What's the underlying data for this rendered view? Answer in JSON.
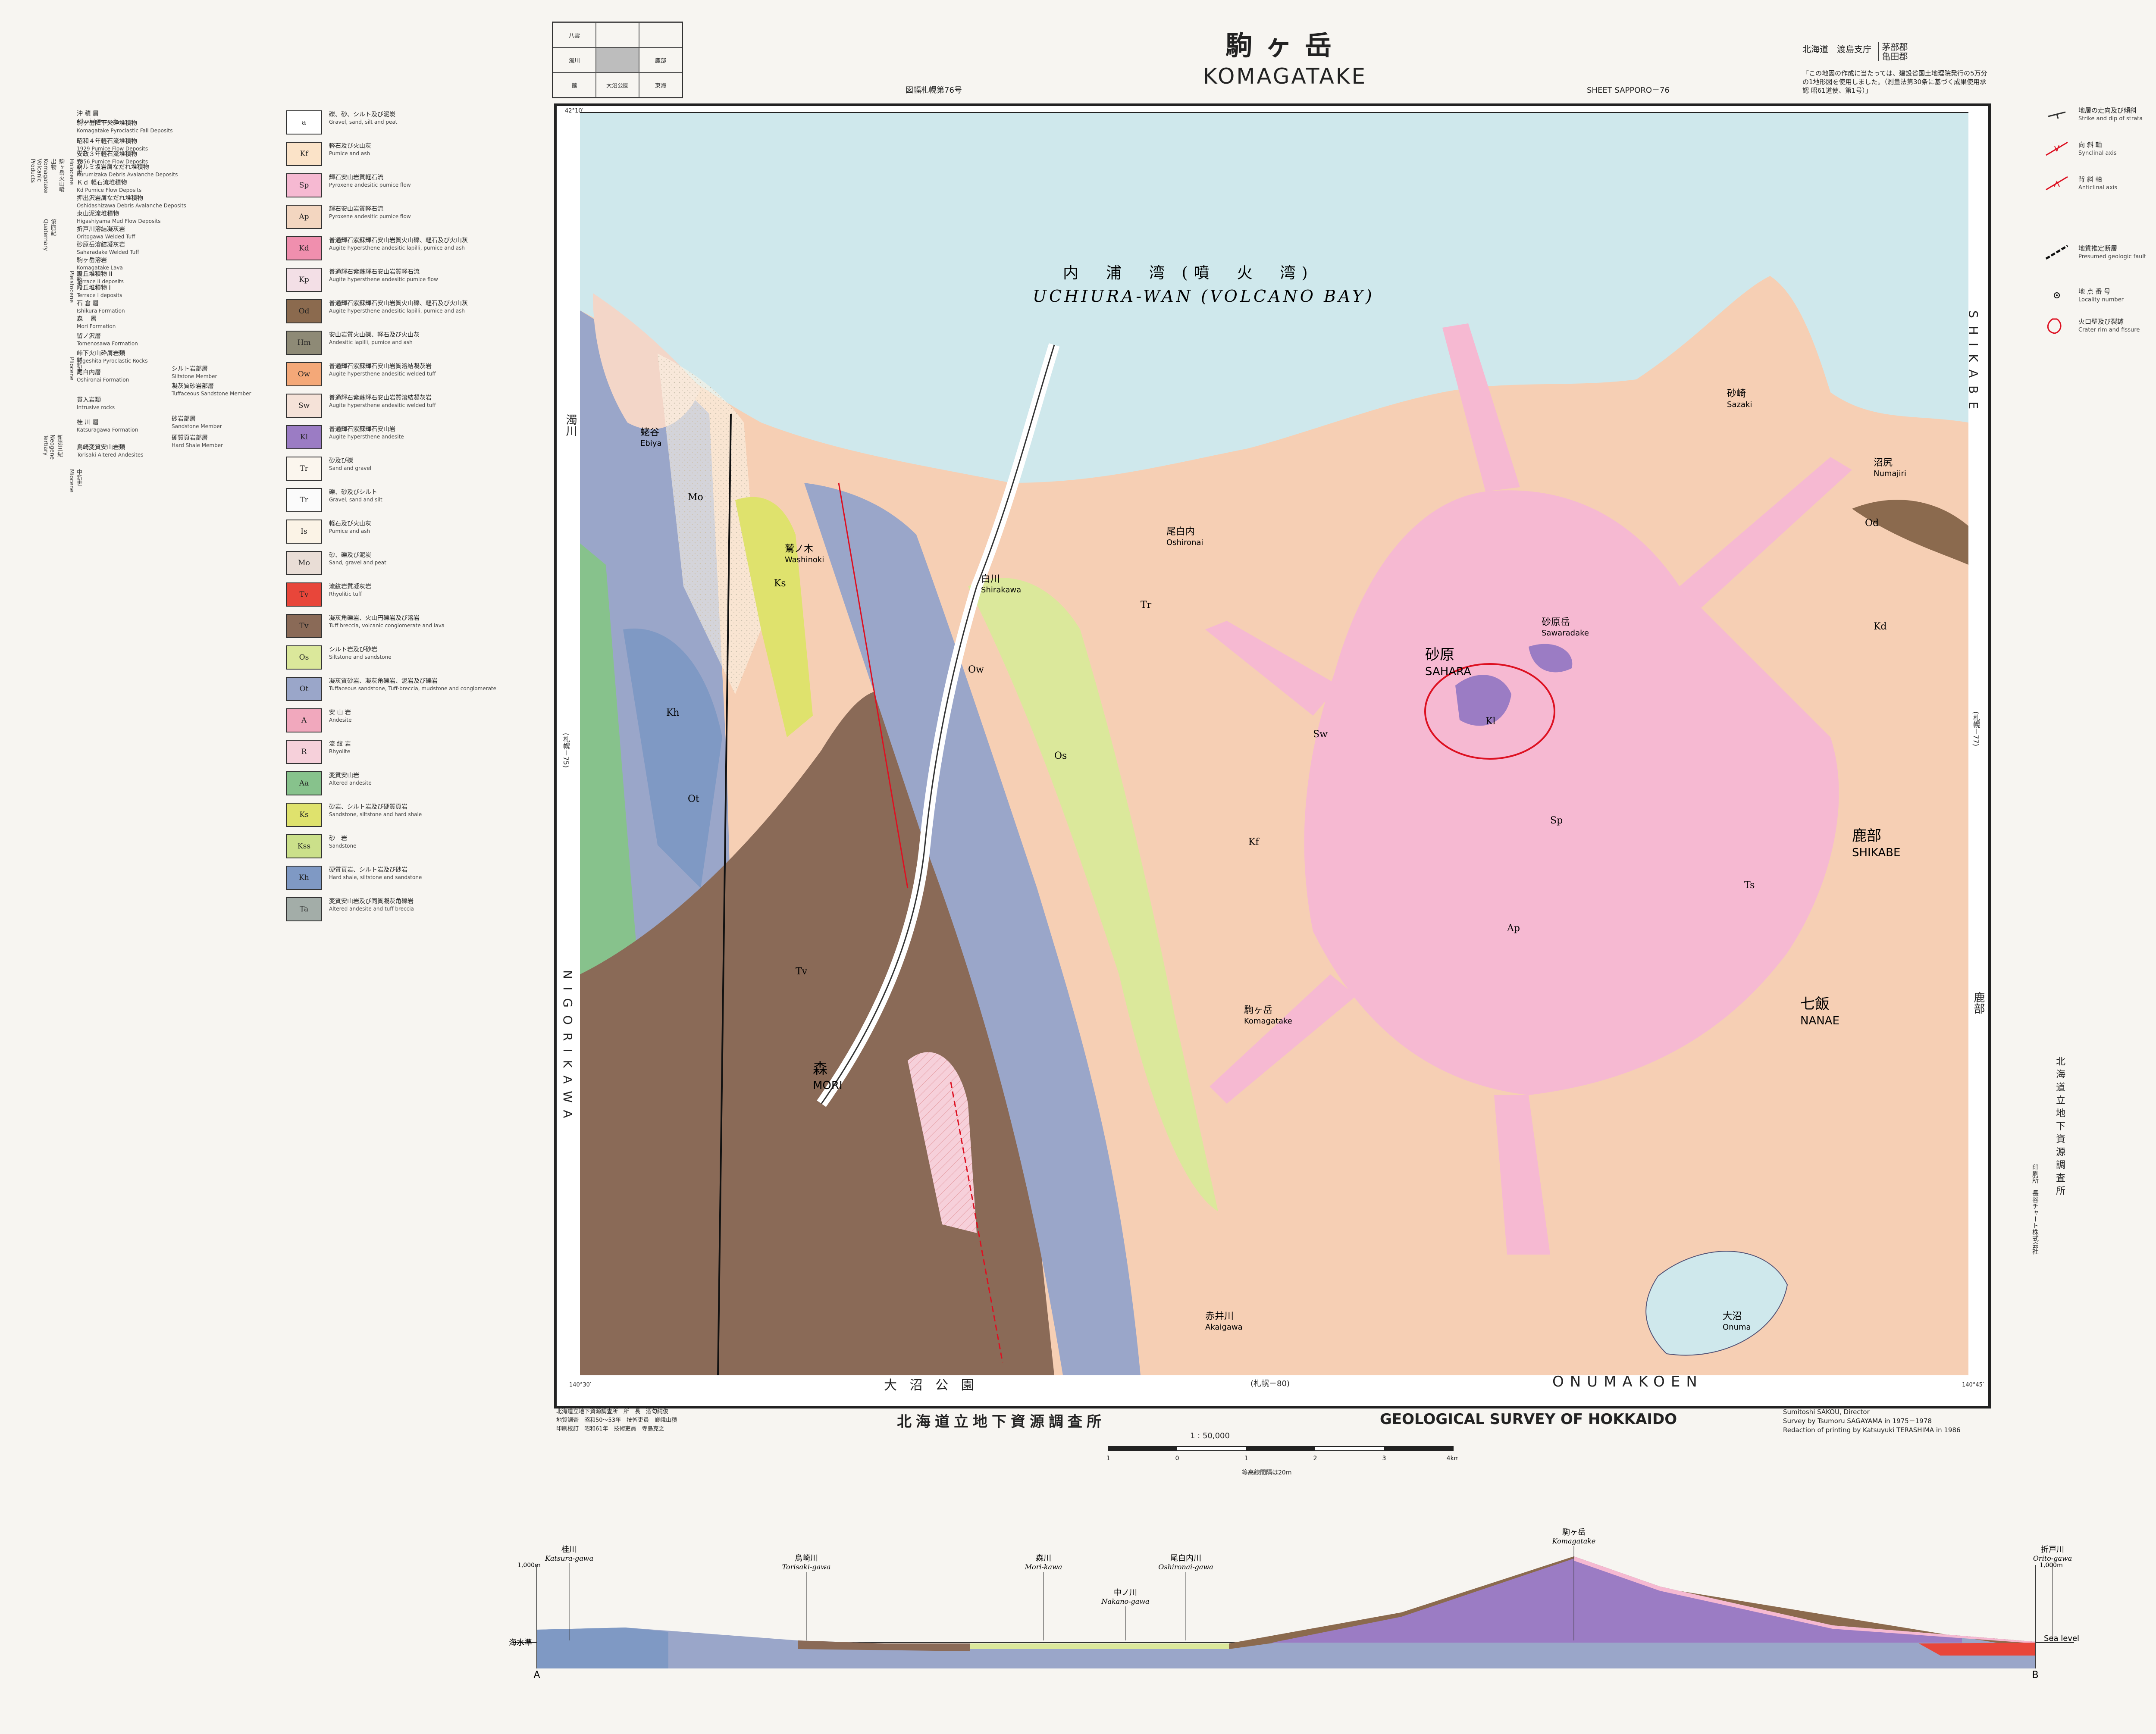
{
  "header": {
    "title_jp": "駒ヶ岳",
    "title_en": "KOMAGATAKE",
    "sheet_left": "図幅札幌第76号",
    "sheet_right": "SHEET SAPPORO－76",
    "prefecture": "北海道　渡島支庁",
    "prefecture_towns": [
      "茅部郡",
      "亀田郡"
    ],
    "notice": "「この地図の作成に当たっては、建設省国土地理院発行の5万分の1地形図を使用しました。（測量法第30条に基づく成果使用承認 昭61道使、第1号）」",
    "index_map": [
      "八雲",
      "",
      "",
      "濁川",
      "",
      "鹿部",
      "館",
      "大沼公園",
      "東海"
    ]
  },
  "map": {
    "bay_jp": "内　浦　湾 (噴　火　湾)",
    "bay_en": "UCHIURA-WAN (VOLCANO BAY)",
    "place_names": [
      {
        "jp": "森",
        "en": "MORI"
      },
      {
        "jp": "砂原",
        "en": "SAHARA"
      },
      {
        "jp": "鹿部",
        "en": "SHIKABE"
      },
      {
        "jp": "七飯",
        "en": "NANAE"
      },
      {
        "jp": "駒ヶ岳",
        "en": "Komagatake"
      },
      {
        "jp": "白川",
        "en": "Shirakawa"
      },
      {
        "jp": "尾白内",
        "en": "Oshironai"
      },
      {
        "jp": "鷲ノ木",
        "en": "Washinoki"
      },
      {
        "jp": "蛯谷",
        "en": "Ebiya"
      },
      {
        "jp": "砂崎",
        "en": "Sazaki"
      },
      {
        "jp": "沼尻",
        "en": "Numajiri"
      },
      {
        "jp": "大沼",
        "en": "Onuma"
      },
      {
        "jp": "赤井川",
        "en": "Akaigawa"
      },
      {
        "jp": "砂原岳",
        "en": "Sawaradake"
      }
    ],
    "left_edge": "NIGORIKAWA",
    "left_edge_jp": "濁川",
    "right_edge": "SHIKABE",
    "right_edge_jp": "鹿部",
    "bottom_edge_jp": "大 沼 公 園",
    "bottom_edge_en": "ONUMAKOEN",
    "sheet_bottom": "(札幌－80)",
    "sheet_left_side": "(札幌－75)",
    "sheet_right_side": "(札幌－77)",
    "corner_lat": "42°10′",
    "corner_lon_left": "140°30′",
    "corner_lon_right": "140°45′",
    "unit_labels": [
      "Kf",
      "Sp",
      "Ap",
      "Kd",
      "Od",
      "Ot",
      "Os",
      "Tv",
      "Kl",
      "Mo",
      "Sw",
      "Ts",
      "Kh",
      "Ks",
      "Tr",
      "Ow"
    ]
  },
  "legend": {
    "strata": [
      {
        "jp": "沖 積 層",
        "en": "Alluvial Deposits"
      },
      {
        "jp": "駒ヶ岳降下火砕堆積物",
        "en": "Komagatake Pyroclastic Fall Deposits"
      },
      {
        "jp": "昭和４年軽石流堆積物",
        "en": "1929 Pumice Flow Deposits"
      },
      {
        "jp": "安政３年軽石流堆積物",
        "en": "1856 Pumice Flow Deposits"
      },
      {
        "jp": "クルミ坂岩屑なだれ堆積物",
        "en": "Kurumizaka Debris Avalanche Deposits"
      },
      {
        "jp": "Ｋｄ 軽石流堆積物",
        "en": "Kd Pumice Flow Deposits"
      },
      {
        "jp": "押出沢岩屑なだれ堆積物",
        "en": "Oshidashizawa Debris Avalanche Deposits"
      },
      {
        "jp": "東山泥流堆積物",
        "en": "Higashiyama Mud Flow Deposits"
      },
      {
        "jp": "折戸川溶結凝灰岩",
        "en": "Oritogawa Welded Tuff"
      },
      {
        "jp": "砂原岳溶結凝灰岩",
        "en": "Saharadake Welded Tuff"
      },
      {
        "jp": "駒ヶ岳溶岩",
        "en": "Komagatake Lava"
      },
      {
        "jp": "段丘堆積物 II",
        "en": "Terrace II deposits"
      },
      {
        "jp": "段丘堆積物 I",
        "en": "Terrace I deposits"
      },
      {
        "jp": "石 倉 層",
        "en": "Ishikura Formation"
      },
      {
        "jp": "森 　層",
        "en": "Mori Formation"
      },
      {
        "jp": "留ノ沢層",
        "en": "Tomenosawa Formation"
      },
      {
        "jp": "峠下火山砕屑岩類",
        "en": "Tôgeshita Pyroclastic Rocks"
      },
      {
        "jp": "尾白内層",
        "en": "Oshironai Formation"
      },
      {
        "jp": "貫入岩類",
        "en": "Intrusive rocks"
      },
      {
        "jp": "桂 川 層",
        "en": "Katsuragawa Formation"
      },
      {
        "jp": "鳥崎変質安山岩類",
        "en": "Torisaki Altered Andesites"
      }
    ],
    "members": [
      {
        "jp": "シルト岩部層",
        "en": "Siltstone Member"
      },
      {
        "jp": "凝灰質砂岩部層",
        "en": "Tuffaceous Sandstone Member"
      },
      {
        "jp": "砂岩部層",
        "en": "Sandstone Member"
      },
      {
        "jp": "硬質頁岩部層",
        "en": "Hard Shale Member"
      }
    ],
    "eras": [
      "完新世 Holocene",
      "更新世 Pleistocene",
      "第四紀 Quaternary",
      "鮮新世 Pliocene",
      "中新世 Miocene",
      "新第三紀 Neogene Tertiary",
      "駒ヶ岳火山噴出物 Komagatake Volcanic Products"
    ],
    "symbols": [
      {
        "code": "a",
        "jp": "礫、砂、シルト及び泥炭",
        "en": "Gravel, sand, silt and peat",
        "color": "#ffffff"
      },
      {
        "code": "Kf",
        "jp": "軽石及び火山灰",
        "en": "Pumice and ash",
        "color": "#fbe3c8"
      },
      {
        "code": "Sp",
        "jp": "輝石安山岩質軽石流",
        "en": "Pyroxene andesitic pumice flow",
        "color": "#f6b9d2"
      },
      {
        "code": "Ap",
        "jp": "輝石安山岩質軽石流",
        "en": "Pyroxene andesitic pumice flow",
        "color": "#f3d6c0"
      },
      {
        "code": "Kd",
        "jp": "普通輝石紫蘇輝石安山岩質火山礫、軽石及び火山灰",
        "en": "Augite hypersthene andesitic lapilli, pumice and ash",
        "color": "#f08fae"
      },
      {
        "code": "Kp",
        "jp": "普通輝石紫蘇輝石安山岩質軽石流",
        "en": "Augite hypersthene andesitic pumice flow",
        "color": "#f3dfe6"
      },
      {
        "code": "Od",
        "jp": "普通輝石紫蘇輝石安山岩質火山礫、軽石及び火山灰",
        "en": "Augite hypersthene andesitic lapilli, pumice and ash",
        "color": "#8b6a4e"
      },
      {
        "code": "Hm",
        "jp": "安山岩質火山礫、軽石及び火山灰",
        "en": "Andesitic lapilli, pumice and ash",
        "color": "#8e8a76"
      },
      {
        "code": "Ow",
        "jp": "普通輝石紫蘇輝石安山岩質溶結凝灰岩",
        "en": "Augite hypersthene andesitic welded tuff",
        "color": "#f4a878"
      },
      {
        "code": "Sw",
        "jp": "普通輝石紫蘇輝石安山岩質溶結凝灰岩",
        "en": "Augite hypersthene andesitic welded tuff",
        "color": "#f5e2d8"
      },
      {
        "code": "Kl",
        "jp": "普通輝石紫蘇輝石安山岩",
        "en": "Augite hypersthene andesite",
        "color": "#9b7cc4"
      },
      {
        "code": "Tr",
        "jp": "砂及び礫",
        "en": "Sand and gravel",
        "color": "#fbf6ee"
      },
      {
        "code": "Tr",
        "jp": "礫、砂及びシルト",
        "en": "Gravel, sand and silt",
        "color": "#fbfbfb"
      },
      {
        "code": "Is",
        "jp": "軽石及び火山灰",
        "en": "Pumice and ash",
        "color": "#fbf3e6"
      },
      {
        "code": "Mo",
        "jp": "砂、礫及び泥炭",
        "en": "Sand, gravel and peat",
        "color": "#e9ddd6"
      },
      {
        "code": "Tv",
        "jp": "流紋岩質凝灰岩",
        "en": "Rhyolitic tuff",
        "color": "#e8463a"
      },
      {
        "code": "Tv",
        "jp": "凝灰角礫岩、火山円礫岩及び溶岩",
        "en": "Tuff breccia, volcanic conglomerate and lava",
        "color": "#8a6a57"
      },
      {
        "code": "Os",
        "jp": "シルト岩及び砂岩",
        "en": "Siltstone and sandstone",
        "color": "#dbe89b"
      },
      {
        "code": "Ot",
        "jp": "凝灰質砂岩、凝灰角礫岩、泥岩及び礫岩",
        "en": "Tuffaceous sandstone, Tuff-breccia, mudstone and conglomerate",
        "color": "#9aa6c9"
      },
      {
        "code": "A",
        "jp": "安 山 岩",
        "en": "Andesite",
        "color": "#f1a8bd"
      },
      {
        "code": "R",
        "jp": "流 紋 岩",
        "en": "Rhyolite",
        "color": "#f6d0da"
      },
      {
        "code": "Aa",
        "jp": "変質安山岩",
        "en": "Altered andesite",
        "color": "#87c28c"
      },
      {
        "code": "Ks",
        "jp": "砂岩、シルト岩及び硬質頁岩",
        "en": "Sandstone, siltstone and hard shale",
        "color": "#dfe26d"
      },
      {
        "code": "Kss",
        "jp": "砂　岩",
        "en": "Sandstone",
        "color": "#cbe08a"
      },
      {
        "code": "Kh",
        "jp": "硬質頁岩、シルト岩及び砂岩",
        "en": "Hard shale, siltstone and sandstone",
        "color": "#7f99c4"
      },
      {
        "code": "Ta",
        "jp": "変質安山岩及び同質凝灰角礫岩",
        "en": "Altered andesite and tuff breccia",
        "color": "#a3ada8"
      }
    ],
    "right": [
      {
        "jp": "地層の走向及び傾斜",
        "en": "Strike and dip of strata"
      },
      {
        "jp": "向 斜 軸",
        "en": "Synclinal axis"
      },
      {
        "jp": "背 斜 軸",
        "en": "Anticlinal axis"
      },
      {
        "jp": "地質推定断層",
        "en": "Presumed geologic fault"
      },
      {
        "jp": "地 点 番 号",
        "en": "Locality number"
      },
      {
        "jp": "火口壁及び裂罅",
        "en": "Crater rim and fissure"
      }
    ]
  },
  "footer": {
    "survey_jp": "北海道立地下資源調査所",
    "survey_en": "GEOLOGICAL SURVEY OF HOKKAIDO",
    "scale": "1 : 50,000",
    "scale_ticks": [
      "1",
      "0",
      "1",
      "2",
      "3",
      "4km"
    ],
    "contour_note": "等高線間隔は20m",
    "credits_left": [
      "北海道立地下資源調査所　所　長　酒匂純俊",
      "地質調査　昭和50～53年　技術吏員　嵯峨山積",
      "印刷校訂　昭和61年　技術吏員　寺島克之"
    ],
    "credits_right": [
      "Sumitoshi SAKOU, Director",
      "Survey by Tsumoru SAGAYAMA in 1975－1978",
      "Redaction of printing by Katsuyuki TERASHIMA in 1986"
    ],
    "publisher_vertical": "北海道立地下資源調査所",
    "printer_vertical": "印刷所　長谷チャート株式会社"
  },
  "cross_section": {
    "labels": [
      {
        "jp": "桂川",
        "en": "Katsura-gawa"
      },
      {
        "jp": "鳥崎川",
        "en": "Torisaki-gawa"
      },
      {
        "jp": "森川",
        "en": "Mori-kawa"
      },
      {
        "jp": "中ノ川",
        "en": "Nakano-gawa"
      },
      {
        "jp": "尾白内川",
        "en": "Oshironai-gawa"
      },
      {
        "jp": "駒ヶ岳",
        "en": "Komagatake"
      },
      {
        "jp": "折戸川",
        "en": "Orito-gawa"
      }
    ],
    "sea_level_jp": "海水準",
    "sea_level_en": "Sea level",
    "height": "1,000m",
    "end_a": "A",
    "end_b": "B"
  }
}
